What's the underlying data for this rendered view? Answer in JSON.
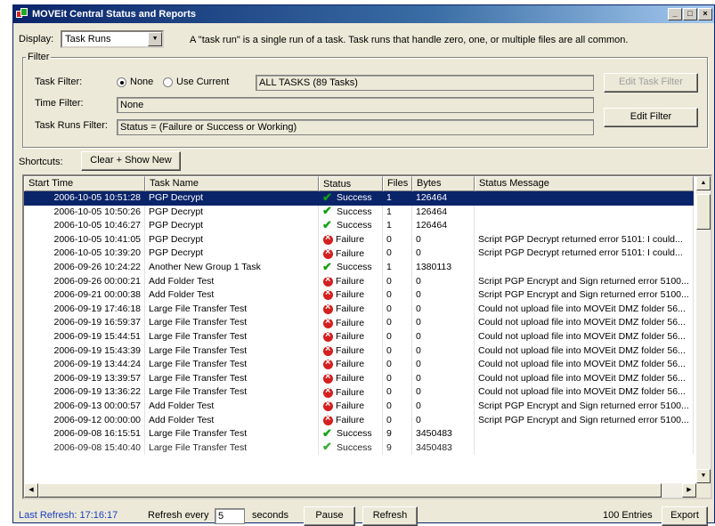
{
  "window": {
    "title": "MOVEit Central Status and Reports",
    "buttons": {
      "minimize": "_",
      "maximize": "□",
      "close": "×"
    }
  },
  "display": {
    "label": "Display:",
    "selected": "Task Runs",
    "hint": "A \"task run\" is a single run of a task. Task runs that handle zero, one, or multiple files are all common."
  },
  "filter": {
    "legend": "Filter",
    "task_filter_label": "Task Filter:",
    "radio_none": "None",
    "radio_use_current": "Use Current",
    "task_filter_value": "ALL TASKS (89 Tasks)",
    "time_filter_label": "Time Filter:",
    "time_filter_value": "None",
    "task_runs_filter_label": "Task Runs Filter:",
    "task_runs_filter_value": "Status = (Failure or Success or Working)",
    "edit_task_filter": "Edit Task Filter",
    "edit_filter": "Edit Filter"
  },
  "shortcuts": {
    "label": "Shortcuts:",
    "clear_show_new": "Clear + Show New"
  },
  "grid": {
    "columns": [
      "Start Time",
      "Task Name",
      "Status",
      "Files",
      "Bytes",
      "Status Message"
    ],
    "rows": [
      {
        "time": "2006-10-05 10:51:28",
        "task": "PGP Decrypt",
        "status": "Success",
        "files": "1",
        "bytes": "126464",
        "msg": ""
      },
      {
        "time": "2006-10-05 10:50:26",
        "task": "PGP Decrypt",
        "status": "Success",
        "files": "1",
        "bytes": "126464",
        "msg": ""
      },
      {
        "time": "2006-10-05 10:46:27",
        "task": "PGP Decrypt",
        "status": "Success",
        "files": "1",
        "bytes": "126464",
        "msg": ""
      },
      {
        "time": "2006-10-05 10:41:05",
        "task": "PGP Decrypt",
        "status": "Failure",
        "files": "0",
        "bytes": "0",
        "msg": "Script PGP Decrypt returned error 5101: I could..."
      },
      {
        "time": "2006-10-05 10:39:20",
        "task": "PGP Decrypt",
        "status": "Failure",
        "files": "0",
        "bytes": "0",
        "msg": "Script PGP Decrypt returned error 5101: I could..."
      },
      {
        "time": "2006-09-26 10:24:22",
        "task": "Another New Group 1 Task",
        "status": "Success",
        "files": "1",
        "bytes": "1380113",
        "msg": ""
      },
      {
        "time": "2006-09-26 00:00:21",
        "task": "Add Folder Test",
        "status": "Failure",
        "files": "0",
        "bytes": "0",
        "msg": "Script PGP Encrypt and Sign returned error 5100..."
      },
      {
        "time": "2006-09-21 00:00:38",
        "task": "Add Folder Test",
        "status": "Failure",
        "files": "0",
        "bytes": "0",
        "msg": "Script PGP Encrypt and Sign returned error 5100..."
      },
      {
        "time": "2006-09-19 17:46:18",
        "task": "Large File Transfer Test",
        "status": "Failure",
        "files": "0",
        "bytes": "0",
        "msg": "Could not upload file into MOVEit DMZ folder 56..."
      },
      {
        "time": "2006-09-19 16:59:37",
        "task": "Large File Transfer Test",
        "status": "Failure",
        "files": "0",
        "bytes": "0",
        "msg": "Could not upload file into MOVEit DMZ folder 56..."
      },
      {
        "time": "2006-09-19 15:44:51",
        "task": "Large File Transfer Test",
        "status": "Failure",
        "files": "0",
        "bytes": "0",
        "msg": "Could not upload file into MOVEit DMZ folder 56..."
      },
      {
        "time": "2006-09-19 15:43:39",
        "task": "Large File Transfer Test",
        "status": "Failure",
        "files": "0",
        "bytes": "0",
        "msg": "Could not upload file into MOVEit DMZ folder 56..."
      },
      {
        "time": "2006-09-19 13:44:24",
        "task": "Large File Transfer Test",
        "status": "Failure",
        "files": "0",
        "bytes": "0",
        "msg": "Could not upload file into MOVEit DMZ folder 56..."
      },
      {
        "time": "2006-09-19 13:39:57",
        "task": "Large File Transfer Test",
        "status": "Failure",
        "files": "0",
        "bytes": "0",
        "msg": "Could not upload file into MOVEit DMZ folder 56..."
      },
      {
        "time": "2006-09-19 13:36:22",
        "task": "Large File Transfer Test",
        "status": "Failure",
        "files": "0",
        "bytes": "0",
        "msg": "Could not upload file into MOVEit DMZ folder 56..."
      },
      {
        "time": "2006-09-13 00:00:57",
        "task": "Add Folder Test",
        "status": "Failure",
        "files": "0",
        "bytes": "0",
        "msg": "Script PGP Encrypt and Sign returned error 5100..."
      },
      {
        "time": "2006-09-12 00:00:00",
        "task": "Add Folder Test",
        "status": "Failure",
        "files": "0",
        "bytes": "0",
        "msg": "Script PGP Encrypt and Sign returned error 5100..."
      },
      {
        "time": "2006-09-08 16:15:51",
        "task": "Large File Transfer Test",
        "status": "Success",
        "files": "9",
        "bytes": "3450483",
        "msg": ""
      },
      {
        "time": "2006-09-08 15:40:40",
        "task": "Large File Transfer Test",
        "status": "Success",
        "files": "9",
        "bytes": "3450483",
        "msg": ""
      }
    ]
  },
  "status_bar": {
    "last_refresh": "Last Refresh: 17:16:17",
    "refresh_every_label": "Refresh every",
    "refresh_value": "5",
    "seconds_label": "seconds",
    "pause": "Pause",
    "refresh": "Refresh",
    "entries": "100 Entries",
    "export": "Export"
  },
  "colors": {
    "selection": "#0a246a",
    "success": "#12a112",
    "failure": "#d42020",
    "last_refresh_text": "#1a3ec2"
  }
}
